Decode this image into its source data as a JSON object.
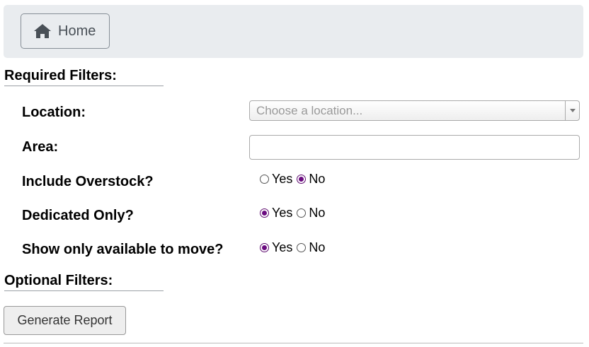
{
  "nav": {
    "home_label": "Home",
    "icon": "home-icon"
  },
  "required": {
    "title": "Required Filters:",
    "location": {
      "label": "Location:",
      "placeholder": "Choose a location..."
    },
    "area": {
      "label": "Area:",
      "value": ""
    },
    "overstock": {
      "label": "Include Overstock?",
      "yes": "Yes",
      "no": "No",
      "selected": "No"
    },
    "dedicated": {
      "label": "Dedicated Only?",
      "yes": "Yes",
      "no": "No",
      "selected": "Yes"
    },
    "available": {
      "label": "Show only available to move?",
      "yes": "Yes",
      "no": "No",
      "selected": "Yes"
    }
  },
  "optional": {
    "title": "Optional Filters:"
  },
  "actions": {
    "generate_label": "Generate Report"
  },
  "colors": {
    "radio_checked": "#6b0b80",
    "topbar_bg": "#e9ecef"
  }
}
